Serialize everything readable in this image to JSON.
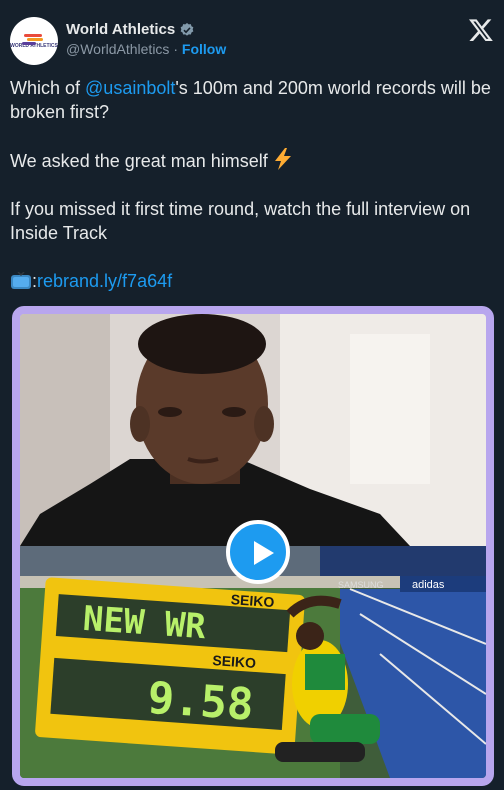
{
  "author": {
    "display_name": "World Athletics",
    "handle": "@WorldAthletics",
    "separator": "·",
    "follow_label": "Follow",
    "avatar_text": "WORLD ATHLETICS"
  },
  "tweet": {
    "line1_prefix": "Which of ",
    "line1_mention": "@usainbolt",
    "line1_suffix": "'s 100m and 200m world records will be broken first?",
    "line2": "We asked the great man himself",
    "line3": "If you missed it first time round, watch the full interview on Inside Track",
    "link_prefix": ":",
    "link": "rebrand.ly/f7a64f"
  },
  "media": {
    "scoreboard_line1": "NEW WR",
    "scoreboard_line2": "9.58",
    "sponsor": "SEIKO",
    "banner": "SAMSUNG",
    "banner2": "adidas"
  },
  "icons": {
    "verified": "verified-badge-icon",
    "x_logo": "x-logo-icon",
    "lightning": "lightning-emoji-icon",
    "tv": "tv-emoji-icon",
    "play": "play-icon"
  },
  "colors": {
    "background": "#15202b",
    "accent": "#1d9bf0",
    "media_border": "#b8a6ee"
  }
}
